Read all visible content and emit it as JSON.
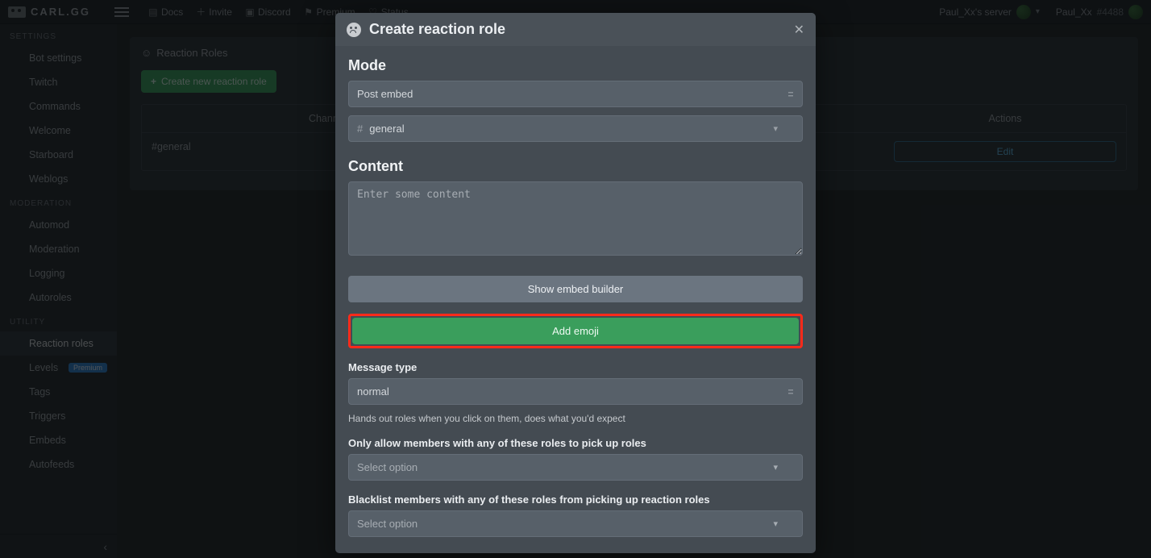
{
  "brand": "CARL.GG",
  "topnav": {
    "docs": "Docs",
    "invite": "Invite",
    "discord": "Discord",
    "premium": "Premium",
    "status": "Status"
  },
  "header": {
    "server_name": "Paul_Xx's server",
    "user_name": "Paul_Xx",
    "user_discrim": "#4488"
  },
  "sidebar": {
    "sections": {
      "settings": {
        "label": "SETTINGS",
        "items": [
          "Bot settings",
          "Twitch",
          "Commands",
          "Welcome",
          "Starboard",
          "Weblogs"
        ]
      },
      "moderation": {
        "label": "MODERATION",
        "items": [
          "Automod",
          "Moderation",
          "Logging",
          "Autoroles"
        ]
      },
      "utility": {
        "label": "UTILITY",
        "items": [
          "Reaction roles",
          "Levels",
          "Tags",
          "Triggers",
          "Embeds",
          "Autofeeds"
        ],
        "levels_badge": "Premium"
      }
    }
  },
  "page": {
    "panel_title": "Reaction Roles",
    "create_button": "Create new reaction role",
    "columns": {
      "channel": "Channel",
      "actions": "Actions"
    },
    "rows": [
      {
        "channel": "#general",
        "edit_label": "Edit"
      }
    ]
  },
  "modal": {
    "title": "Create reaction role",
    "mode_section": "Mode",
    "mode_value": "Post embed",
    "channel_value": "general",
    "content_section": "Content",
    "content_placeholder": "Enter some content",
    "show_embed_builder": "Show embed builder",
    "add_emoji": "Add emoji",
    "message_type_label": "Message type",
    "message_type_value": "normal",
    "message_type_help": "Hands out roles when you click on them, does what you'd expect",
    "whitelist_label": "Only allow members with any of these roles to pick up roles",
    "whitelist_placeholder": "Select option",
    "blacklist_label": "Blacklist members with any of these roles from picking up reaction roles",
    "blacklist_placeholder": "Select option"
  }
}
